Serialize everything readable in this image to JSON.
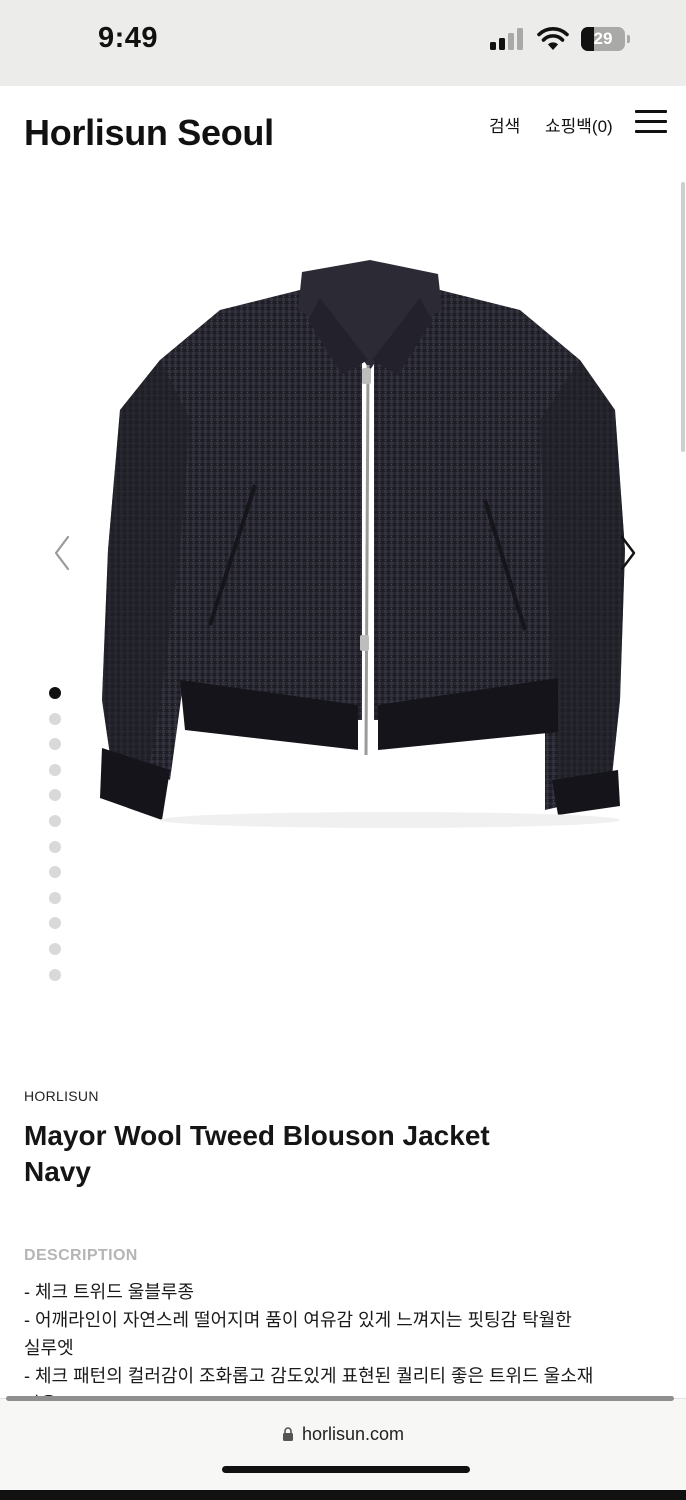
{
  "status_bar": {
    "time": "9:49",
    "battery_level": "29",
    "signal_bars_active": 2,
    "signal_bars_total": 4
  },
  "header": {
    "brand": "Horlisun Seoul",
    "search_label": "검색",
    "cart_label": "쇼핑백(0)",
    "menu_icon": "hamburger-menu-icon"
  },
  "gallery": {
    "image_alt": "Mayor Wool Tweed Blouson Jacket Navy",
    "prev_icon": "chevron-left-icon",
    "next_icon": "chevron-right-icon",
    "image_count": 12,
    "current_index": 1,
    "jacket_color": "#26262f",
    "rib_color": "#14141a"
  },
  "product": {
    "vendor": "HORLISUN",
    "title_line1": "Mayor Wool Tweed Blouson Jacket",
    "title_line2": "Navy",
    "description_label": "DESCRIPTION",
    "description_lines": [
      " - 체크 트위드 울블루종",
      " - 어깨라인이 자연스레 떨어지며 품이 여유감 있게 느껴지는 핏팅감 탁월한",
      "실루엣",
      " - 체크 패턴의 컬러감이 조화롭고 감도있게 표현된 퀄리티 좋은 트위드 울소재",
      "사용"
    ]
  },
  "browser": {
    "url": "horlisun.com",
    "lock_icon": "lock-icon"
  },
  "colors": {
    "status_bar_bg": "#ececea",
    "text": "#111111",
    "muted_label": "#b5b5b5",
    "dot_inactive": "#d9d9d9",
    "dot_active": "#111111"
  }
}
